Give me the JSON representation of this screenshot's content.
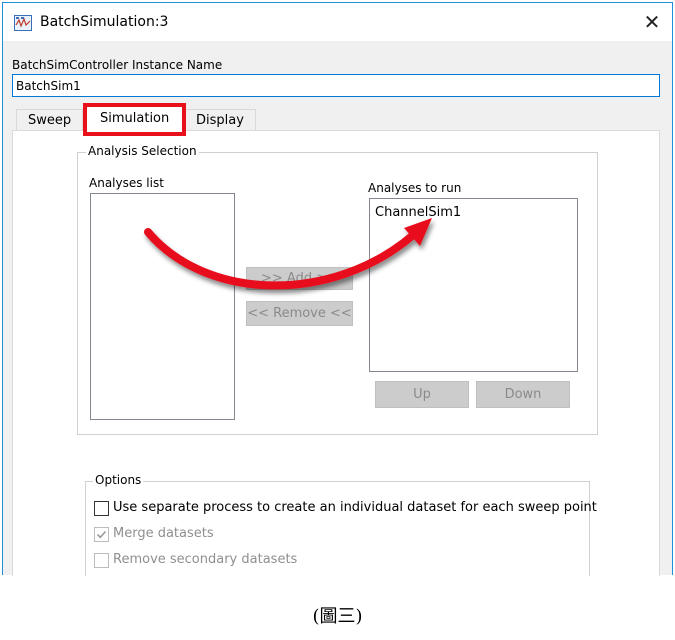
{
  "window": {
    "title": "BatchSimulation:3",
    "close_glyph": "✕",
    "icon": "batch-simulation-app-icon"
  },
  "instance": {
    "label": "BatchSimController Instance Name",
    "value": "BatchSim1"
  },
  "tabs": [
    {
      "label": "Sweep",
      "selected": false
    },
    {
      "label": "Simulation",
      "selected": true,
      "highlight_color": "#e8101b"
    },
    {
      "label": "Display",
      "selected": false
    }
  ],
  "analysis": {
    "group_title": "Analysis Selection",
    "analyses_list_label": "Analyses list",
    "analyses_list_items": [],
    "analyses_to_run_label": "Analyses to run",
    "analyses_to_run_items": [
      "ChannelSim1"
    ],
    "add_button": ">> Add >>",
    "remove_button": "<< Remove <<",
    "up_button": "Up",
    "down_button": "Down"
  },
  "options": {
    "group_title": "Options",
    "items": [
      {
        "label": "Use separate process to create an individual dataset for each sweep point",
        "checked": false,
        "enabled": true
      },
      {
        "label": "Merge datasets",
        "checked": true,
        "enabled": false
      },
      {
        "label": "Remove secondary datasets",
        "checked": false,
        "enabled": false
      }
    ]
  },
  "annotation": {
    "arrow_color": "#e8101b",
    "arrow_from": "analyses-list",
    "arrow_to": "analyses-to-run"
  },
  "caption": "(圖三)",
  "colors": {
    "window_border": "#1f8fdc",
    "input_focus": "#0078d7",
    "disabled_button": "#cccccc"
  }
}
